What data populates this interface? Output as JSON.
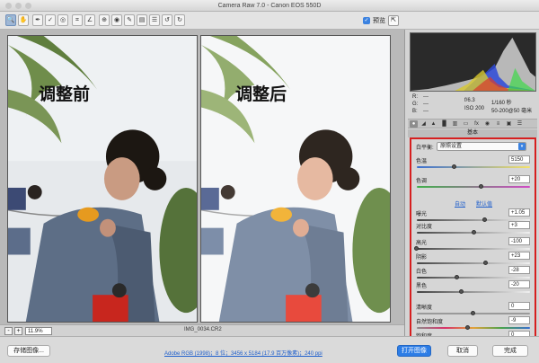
{
  "window": {
    "title": "Camera Raw 7.0 - Canon EOS 550D"
  },
  "toolbar": {
    "tools": [
      "zoom-icon",
      "hand-icon",
      "white-balance-icon",
      "color-sampler-icon",
      "target-adjust-icon",
      "crop-icon",
      "straighten-icon",
      "spot-removal-icon",
      "red-eye-icon",
      "brush-icon",
      "graduated-filter-icon",
      "preferences-icon",
      "rotate-left-icon",
      "rotate-right-icon"
    ],
    "preview_label": "预览"
  },
  "image": {
    "before_label": "调整前",
    "after_label": "调整后",
    "zoom": "11.9%",
    "filename": "IMG_0034.CR2"
  },
  "readout": {
    "r_label": "R:",
    "r_value": "---",
    "g_label": "G:",
    "g_value": "---",
    "b_label": "B:",
    "b_value": "---",
    "aperture": "f/6.3",
    "shutter": "1/160 秒",
    "iso": "ISO 200",
    "lens": "50-200@50 毫米"
  },
  "panel": {
    "section_title": "基本",
    "white_balance_label": "白平衡:",
    "white_balance_value": "原照设置",
    "auto_label": "自动",
    "default_label": "默认值",
    "sliders": [
      {
        "label": "色温",
        "value": "5150",
        "position": 0.33
      },
      {
        "label": "色调",
        "value": "+20",
        "position": 0.57
      },
      {
        "label": "曝光",
        "value": "+1.05",
        "position": 0.6
      },
      {
        "label": "对比度",
        "value": "+3",
        "position": 0.51
      },
      {
        "label": "高光",
        "value": "-100",
        "position": 0.0
      },
      {
        "label": "阴影",
        "value": "+23",
        "position": 0.61
      },
      {
        "label": "白色",
        "value": "-28",
        "position": 0.36
      },
      {
        "label": "黑色",
        "value": "-20",
        "position": 0.4
      },
      {
        "label": "清晰度",
        "value": "0",
        "position": 0.5
      },
      {
        "label": "自然饱和度",
        "value": "-9",
        "position": 0.45
      },
      {
        "label": "饱和度",
        "value": "0",
        "position": 0.5
      }
    ]
  },
  "bottom": {
    "save_label": "存储图像...",
    "info_text": "Adobe RGB (1998)；8 位；3456 x 5184 (17.9 百万像素)；240 ppi",
    "open_label": "打开图像",
    "cancel_label": "取消",
    "done_label": "完成"
  },
  "colors": {
    "accent": "#2d7de6",
    "highlight_box": "#d61f1f"
  }
}
